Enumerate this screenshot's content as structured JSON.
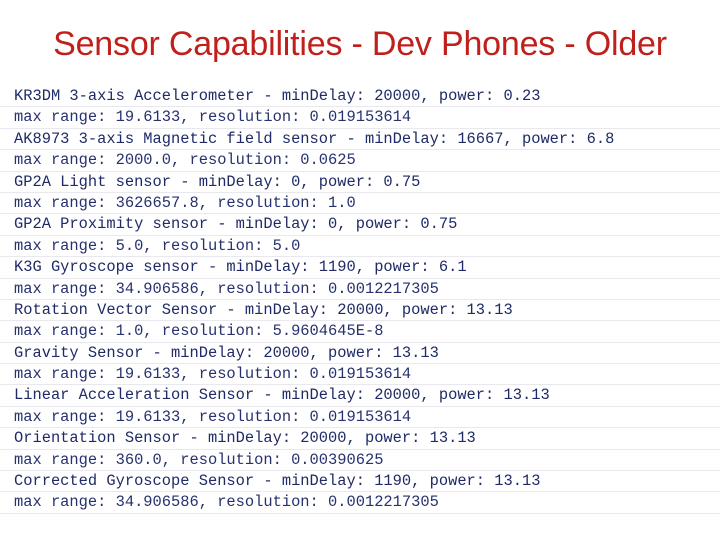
{
  "slide": {
    "title": "Sensor Capabilities - Dev Phones - Older",
    "title_color": "#C0201C",
    "body_color": "#1F2A66",
    "background_color": "#FFFFFF",
    "lines": [
      {
        "text": "KR3DM 3-axis Accelerometer - minDelay: 20000, power: 0.23",
        "kind": "header"
      },
      {
        "text": "max range: 19.6133, resolution: 0.019153614",
        "kind": "detail"
      },
      {
        "text": "AK8973 3-axis Magnetic field sensor - minDelay: 16667, power: 6.8",
        "kind": "header"
      },
      {
        "text": "max range: 2000.0, resolution: 0.0625",
        "kind": "detail"
      },
      {
        "text": "GP2A Light sensor - minDelay: 0, power: 0.75",
        "kind": "header"
      },
      {
        "text": "max range: 3626657.8, resolution: 1.0",
        "kind": "detail"
      },
      {
        "text": "GP2A Proximity sensor - minDelay: 0, power: 0.75",
        "kind": "header"
      },
      {
        "text": "max range: 5.0, resolution: 5.0",
        "kind": "detail"
      },
      {
        "text": "K3G Gyroscope sensor - minDelay: 1190, power: 6.1",
        "kind": "header"
      },
      {
        "text": "max range: 34.906586, resolution: 0.0012217305",
        "kind": "detail"
      },
      {
        "text": "Rotation Vector Sensor - minDelay: 20000, power: 13.13",
        "kind": "header"
      },
      {
        "text": "max range: 1.0, resolution: 5.9604645E-8",
        "kind": "detail"
      },
      {
        "text": "Gravity Sensor - minDelay: 20000, power: 13.13",
        "kind": "header"
      },
      {
        "text": "max range: 19.6133, resolution: 0.019153614",
        "kind": "detail"
      },
      {
        "text": "Linear Acceleration Sensor - minDelay: 20000, power: 13.13",
        "kind": "header"
      },
      {
        "text": "max range: 19.6133, resolution: 0.019153614",
        "kind": "detail"
      },
      {
        "text": "Orientation Sensor - minDelay: 20000, power: 13.13",
        "kind": "header"
      },
      {
        "text": "max range: 360.0, resolution: 0.00390625",
        "kind": "detail"
      },
      {
        "text": "Corrected Gyroscope Sensor - minDelay: 1190, power: 13.13",
        "kind": "header"
      },
      {
        "text": "max range: 34.906586, resolution: 0.0012217305",
        "kind": "detail"
      }
    ]
  }
}
